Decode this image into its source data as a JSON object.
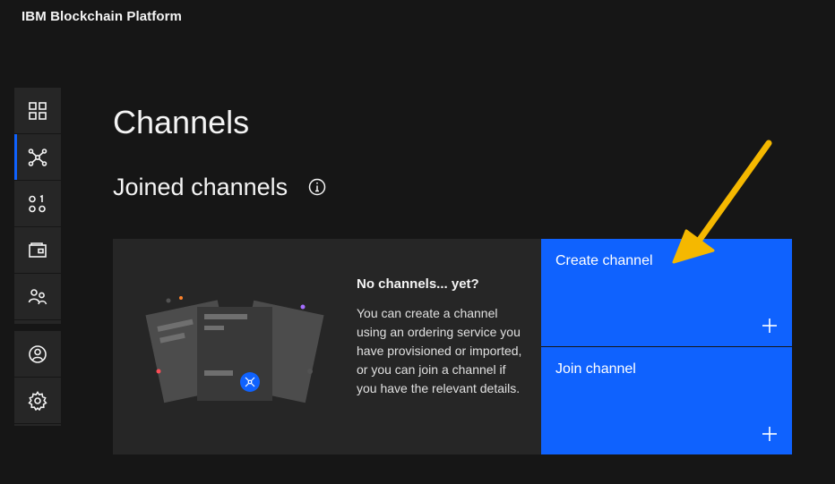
{
  "header": {
    "app_title": "IBM Blockchain Platform"
  },
  "sidebar": {
    "top_items": [
      {
        "name": "dashboard",
        "icon": "grid-icon"
      },
      {
        "name": "channels",
        "icon": "network-icon",
        "active": true
      },
      {
        "name": "smart-contracts",
        "icon": "binary-icon"
      },
      {
        "name": "wallet",
        "icon": "wallet-icon"
      },
      {
        "name": "users",
        "icon": "user-group-icon"
      }
    ],
    "bottom_items": [
      {
        "name": "profile",
        "icon": "user-circle-icon"
      },
      {
        "name": "settings",
        "icon": "gear-icon"
      }
    ]
  },
  "main": {
    "page_title": "Channels",
    "section_title": "Joined channels",
    "empty_state": {
      "heading": "No channels... yet?",
      "body": "You can create a channel using an ordering service you have provisioned or imported, or you can join a channel if you have the relevant details."
    },
    "tiles": {
      "create": "Create channel",
      "join": "Join channel"
    }
  },
  "colors": {
    "background": "#161616",
    "panel": "#262626",
    "accent": "#0f62fe",
    "annotation_arrow": "#f5b800"
  }
}
